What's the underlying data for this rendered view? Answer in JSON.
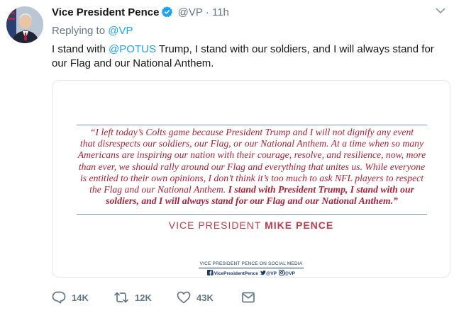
{
  "author": {
    "name": "Vice President Pence",
    "handle": "@VP",
    "separator": "·",
    "time": "11h"
  },
  "replying": {
    "prefix": "Replying to",
    "to": "@VP"
  },
  "tweet": {
    "before": "I stand with ",
    "mention": "@POTUS",
    "after": " Trump, I stand with our soldiers, and I will always stand for our Flag and our National Anthem."
  },
  "card": {
    "quote_lines": [
      "“I left today’s Colts game because President Trump and I will not dignify any event",
      "that disrespects our soldiers, our Flag, or our National Anthem. At a time when so many",
      "Americans are inspiring our nation with their courage, resolve, and resilience, now, more",
      "than ever, we should rally around our Flag and everything that unites us. While everyone",
      "is entitled to their own opinions, I don’t think it’s too much to ask NFL players to respect"
    ],
    "quote_line6_normal": "the Flag and our National Anthem. ",
    "quote_line6_bold": "I stand with President Trump, I stand with our",
    "quote_line7_bold": "soldiers, and I will always stand for our Flag and our National Anthem.”",
    "signature_prefix": "VICE PRESIDENT",
    "signature_name": "MIKE PENCE",
    "social_title": "VICE PRESIDENT PENCE ON SOCIAL MEDIA",
    "social_facebook": "/VicePresidentPence",
    "social_twitter": "@VP",
    "social_instagram": "@VP"
  },
  "actions": {
    "replies": "14K",
    "retweets": "12K",
    "likes": "43K"
  },
  "colors": {
    "link": "#1da1f2",
    "muted": "#657786",
    "quote": "#a8243a",
    "verified": "#1da1f2"
  }
}
